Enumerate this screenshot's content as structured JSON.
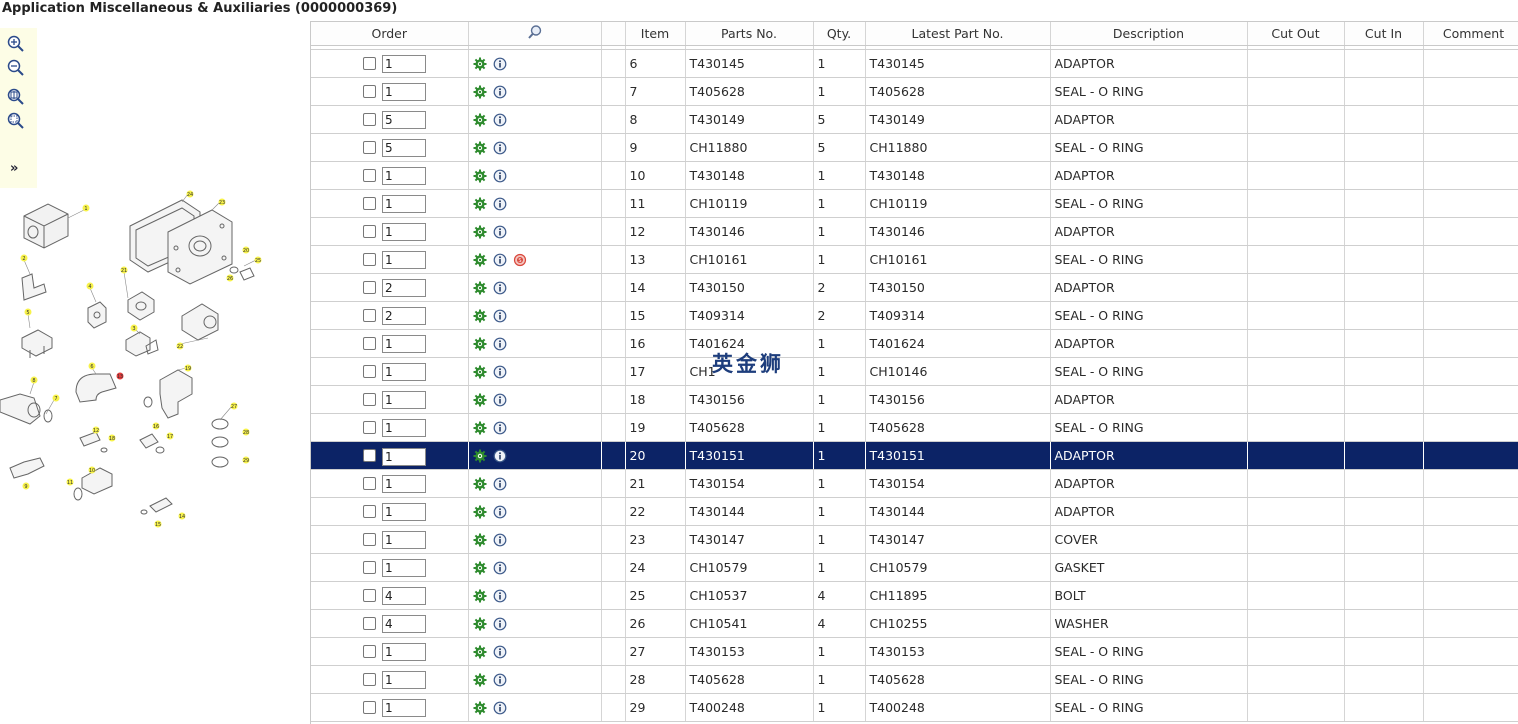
{
  "page": {
    "title": "Application Miscellaneous & Auxiliaries (0000000369)"
  },
  "toolbar": {
    "tools": [
      "zoom-in-icon",
      "zoom-out-icon",
      "zoom-fit-icon",
      "zoom-area-icon"
    ],
    "expand_label": "»"
  },
  "diagram": {
    "callouts": [
      "1",
      "2",
      "3",
      "4",
      "5",
      "6",
      "7",
      "8",
      "9",
      "10",
      "11",
      "12",
      "13",
      "14",
      "15",
      "16",
      "17",
      "18",
      "19",
      "20",
      "21",
      "22",
      "23",
      "24",
      "25",
      "26",
      "27",
      "28",
      "29"
    ]
  },
  "table": {
    "columns": [
      "Order",
      "",
      "",
      "Item",
      "Parts No.",
      "Qty.",
      "Latest Part No.",
      "Description",
      "Cut Out",
      "Cut In",
      "Comment"
    ],
    "search_icon": "magnifier-icon",
    "rows": [
      {
        "order_qty": "1",
        "item": "6",
        "part_no": "T430145",
        "qty": "1",
        "latest": "T430145",
        "desc": "ADAPTOR"
      },
      {
        "order_qty": "1",
        "item": "7",
        "part_no": "T405628",
        "qty": "1",
        "latest": "T405628",
        "desc": "SEAL - O RING"
      },
      {
        "order_qty": "5",
        "item": "8",
        "part_no": "T430149",
        "qty": "5",
        "latest": "T430149",
        "desc": "ADAPTOR"
      },
      {
        "order_qty": "5",
        "item": "9",
        "part_no": "CH11880",
        "qty": "5",
        "latest": "CH11880",
        "desc": "SEAL - O RING"
      },
      {
        "order_qty": "1",
        "item": "10",
        "part_no": "T430148",
        "qty": "1",
        "latest": "T430148",
        "desc": "ADAPTOR"
      },
      {
        "order_qty": "1",
        "item": "11",
        "part_no": "CH10119",
        "qty": "1",
        "latest": "CH10119",
        "desc": "SEAL - O RING"
      },
      {
        "order_qty": "1",
        "item": "12",
        "part_no": "T430146",
        "qty": "1",
        "latest": "T430146",
        "desc": "ADAPTOR"
      },
      {
        "order_qty": "1",
        "item": "13",
        "part_no": "CH10161",
        "qty": "1",
        "latest": "CH10161",
        "desc": "SEAL - O RING",
        "flag": true
      },
      {
        "order_qty": "2",
        "item": "14",
        "part_no": "T430150",
        "qty": "2",
        "latest": "T430150",
        "desc": "ADAPTOR"
      },
      {
        "order_qty": "2",
        "item": "15",
        "part_no": "T409314",
        "qty": "2",
        "latest": "T409314",
        "desc": "SEAL - O RING"
      },
      {
        "order_qty": "1",
        "item": "16",
        "part_no": "T401624",
        "qty": "1",
        "latest": "T401624",
        "desc": "ADAPTOR"
      },
      {
        "order_qty": "1",
        "item": "17",
        "part_no": "CH1",
        "qty": "1",
        "latest": "CH10146",
        "desc": "SEAL - O RING"
      },
      {
        "order_qty": "1",
        "item": "18",
        "part_no": "T430156",
        "qty": "1",
        "latest": "T430156",
        "desc": "ADAPTOR"
      },
      {
        "order_qty": "1",
        "item": "19",
        "part_no": "T405628",
        "qty": "1",
        "latest": "T405628",
        "desc": "SEAL - O RING"
      },
      {
        "order_qty": "1",
        "item": "20",
        "part_no": "T430151",
        "qty": "1",
        "latest": "T430151",
        "desc": "ADAPTOR",
        "selected": true
      },
      {
        "order_qty": "1",
        "item": "21",
        "part_no": "T430154",
        "qty": "1",
        "latest": "T430154",
        "desc": "ADAPTOR"
      },
      {
        "order_qty": "1",
        "item": "22",
        "part_no": "T430144",
        "qty": "1",
        "latest": "T430144",
        "desc": "ADAPTOR"
      },
      {
        "order_qty": "1",
        "item": "23",
        "part_no": "T430147",
        "qty": "1",
        "latest": "T430147",
        "desc": "COVER"
      },
      {
        "order_qty": "1",
        "item": "24",
        "part_no": "CH10579",
        "qty": "1",
        "latest": "CH10579",
        "desc": "GASKET"
      },
      {
        "order_qty": "4",
        "item": "25",
        "part_no": "CH10537",
        "qty": "4",
        "latest": "CH11895",
        "desc": "BOLT"
      },
      {
        "order_qty": "4",
        "item": "26",
        "part_no": "CH10541",
        "qty": "4",
        "latest": "CH10255",
        "desc": "WASHER"
      },
      {
        "order_qty": "1",
        "item": "27",
        "part_no": "T430153",
        "qty": "1",
        "latest": "T430153",
        "desc": "SEAL - O RING"
      },
      {
        "order_qty": "1",
        "item": "28",
        "part_no": "T405628",
        "qty": "1",
        "latest": "T405628",
        "desc": "SEAL - O RING"
      },
      {
        "order_qty": "1",
        "item": "29",
        "part_no": "T400248",
        "qty": "1",
        "latest": "T400248",
        "desc": "SEAL - O RING"
      }
    ]
  },
  "watermark": {
    "text": "英金狮",
    "color": "#1d3d7c"
  },
  "colors": {
    "selected_row": "#0c2366",
    "toolbar_bg": "#fdfde6",
    "gear_icon": "#2e8b2e",
    "flag_icon": "#d9463b"
  }
}
